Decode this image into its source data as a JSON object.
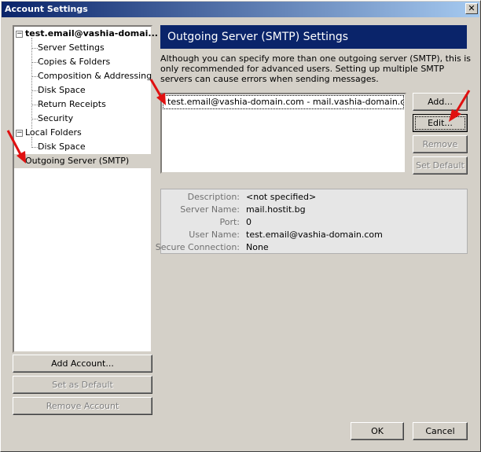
{
  "window": {
    "title": "Account Settings",
    "close_glyph": "✕"
  },
  "tree": {
    "items": [
      {
        "label": "test.email@vashia-domai...",
        "kind": "account"
      },
      {
        "label": "Server Settings",
        "kind": "child"
      },
      {
        "label": "Copies & Folders",
        "kind": "child"
      },
      {
        "label": "Composition & Addressing",
        "kind": "child"
      },
      {
        "label": "Disk Space",
        "kind": "child"
      },
      {
        "label": "Return Receipts",
        "kind": "child"
      },
      {
        "label": "Security",
        "kind": "child"
      },
      {
        "label": "Local Folders",
        "kind": "account"
      },
      {
        "label": "Disk Space",
        "kind": "child"
      },
      {
        "label": "Outgoing Server (SMTP)",
        "kind": "selected"
      }
    ],
    "expander_glyph": "−"
  },
  "left_buttons": {
    "add_account": "Add Account...",
    "set_default": "Set as Default",
    "remove_account": "Remove Account"
  },
  "panel": {
    "title": "Outgoing Server (SMTP) Settings",
    "description": "Although you can specify more than one outgoing server (SMTP), this is only recommended for advanced users. Setting up multiple SMTP servers can cause errors when sending messages.",
    "server_entry": "test.email@vashia-domain.com - mail.vashia-domain.com (D...",
    "buttons": {
      "add": "Add...",
      "edit": "Edit...",
      "remove": "Remove",
      "set_default": "Set Default"
    },
    "details": {
      "description_label": "Description:",
      "description_value": "<not specified>",
      "server_name_label": "Server Name:",
      "server_name_value": "mail.hostit.bg",
      "port_label": "Port:",
      "port_value": "0",
      "user_name_label": "User Name:",
      "user_name_value": "test.email@vashia-domain.com",
      "secure_label": "Secure Connection:",
      "secure_value": "None"
    }
  },
  "footer": {
    "ok": "OK",
    "cancel": "Cancel"
  },
  "colors": {
    "accent": "#0a246a",
    "arrow": "#e01010",
    "face": "#d4d0c8"
  }
}
